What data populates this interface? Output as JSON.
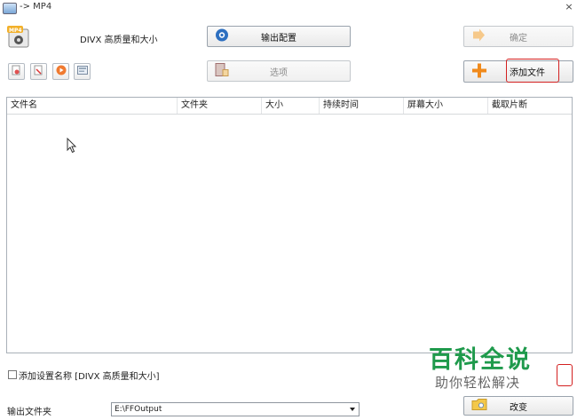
{
  "window": {
    "title": "-> MP4",
    "close": "×"
  },
  "profile": {
    "name": "DIVX 高质量和大小"
  },
  "buttons": {
    "output_settings": "输出配置",
    "options": "选项",
    "ok": "确定",
    "add_file": "添加文件",
    "change": "改变"
  },
  "table": {
    "columns": [
      "文件名",
      "文件夹",
      "大小",
      "持续时间",
      "屏幕大小",
      "截取片断"
    ]
  },
  "bottom": {
    "add_name_label": "添加设置名称 [DIVX 高质量和大小]",
    "output_folder_label": "输出文件夹",
    "output_folder_value": "E:\\FFOutput"
  },
  "watermark": {
    "logo": "百科全说",
    "subtitle": "助你轻松解决"
  },
  "colors": {
    "highlight": "#d32020",
    "watermark_green": "#1f9a4c",
    "add_orange": "#f08a1c"
  }
}
